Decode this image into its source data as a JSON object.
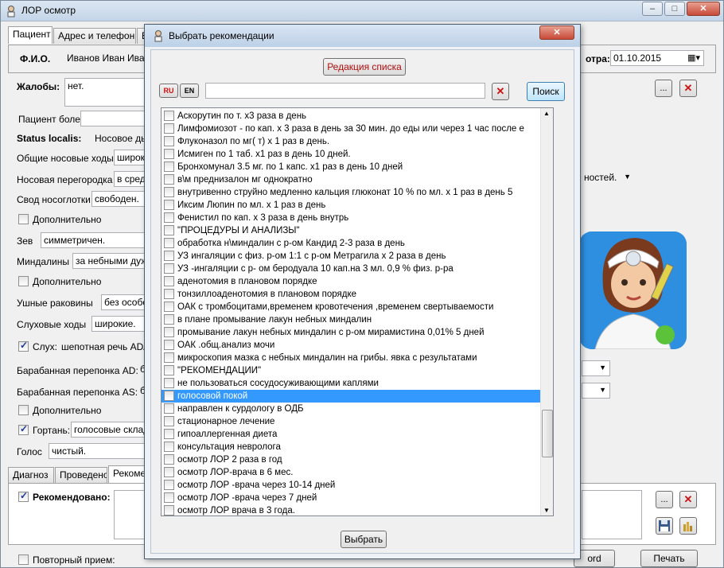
{
  "main": {
    "title": "ЛОР осмотр",
    "tabs": [
      "Пациент",
      "Адрес и телефон",
      "Вр"
    ],
    "fio_label": "Ф.И.О.",
    "fio_value": "Иванов Иван Иван",
    "date_label": "отра:",
    "date_value": "01.10.2015",
    "complaints_label": "Жалобы:",
    "complaints_value": "нет.",
    "patient_ill_label": "Пациент болен",
    "status_label": "Status localis:",
    "status_value": "Носовое ды",
    "rows": [
      {
        "label": "Общие носовые ходы",
        "value": "широки"
      },
      {
        "label": "Носовая перегородка",
        "value": "в средн"
      },
      {
        "label": "Свод носоглотки",
        "value": "свободен."
      },
      {
        "label": "Зев",
        "value": "симметричен."
      },
      {
        "label": "Миндалины",
        "value": "за небными дужк"
      },
      {
        "label": "Ушные раковины",
        "value": "без особе"
      },
      {
        "label": "Слуховые ходы",
        "value": "широкие."
      },
      {
        "label": "Барабанная перепонка AD:",
        "value": "б"
      },
      {
        "label": "Барабанная перепонка AS:",
        "value": "б"
      },
      {
        "label": "Голос",
        "value": "чистый."
      }
    ],
    "nose_right_value": "ностей.",
    "extra_label": "Дополнительно",
    "hearing_label": "Слух:",
    "hearing_value": "шепотная речь AD/AS",
    "larynx_label": "Гортань:",
    "larynx_value": "голосовые склад",
    "bottom_tabs": [
      "Диагноз",
      "Проведено",
      "Рекоме"
    ],
    "recommended_label": "Рекомендовано:",
    "repeat_label": "Повторный прием:",
    "word_btn": "ord",
    "print_btn": "Печать",
    "small_btn": "..."
  },
  "dialog": {
    "title": "Выбрать рекомендации",
    "edit_list_btn": "Редакция списка",
    "lang_ru": "RU",
    "lang_en": "EN",
    "search_value": "",
    "search_btn": "Поиск",
    "select_btn": "Выбрать",
    "selected_index": 23,
    "items": [
      "Аскорутин по   т. х3 раза в день",
      "Лимфомиозот - по   кап. х 3 раза в день за 30 мин. до еды или через 1 час после е",
      "Флуконазол по   мг(   т)  х 1 раз в день.",
      "Исмиген по 1 таб. х1 раз в день 10 дней.",
      "Бронхомунал 3.5 мг. по 1 капс. х1 раз в день 10 дней",
      "в\\м преднизалон  мг однократно",
      "внутривенно струйно медленно кальция глюконат 10 % по     мл.  х 1 раз в день 5",
      "Иксим Люпин по   мл. х 1 раз в день",
      "Фенистил по    кап. х 3 раза в день внутрь",
      "\"ПРОЦЕДУРЫ И АНАЛИЗЫ\"",
      "обработка н\\миндалин с р-ом Кандид 2-3 раза в день",
      "УЗ ингаляции с физ. р-ом 1:1 с р-ом Метрагила х 2 раза в день",
      "УЗ -ингаляции с р- ом беродуала 10 кап.на 3 мл. 0,9 % физ. р-ра",
      "аденотомия в плановом порядке",
      "тонзиллоаденотомия в плановом порядке",
      "ОАК с тромбоцитами,временем кровотечения ,временем свертываемости",
      "в плане промывание лакун небных миндалин",
      "промывание лакун небных миндалин с р-ом мирамистина 0,01%  5 дней",
      "ОАК .общ.анализ мочи",
      "микроскопия мазка с небных миндалин на грибы. явка с результатами",
      "\"РЕКОМЕНДАЦИИ\"",
      "не пользоваться сосудосуживающими каплями",
      "голосовой покой",
      "направлен к сурдологу в ОДБ",
      "стационарное лечение",
      "гипоаллергенная диета",
      "консультация невролога",
      "осмотр ЛОР 2 раза в год",
      "осмотр ЛОР-врача в 6 мес.",
      "осмотр ЛОР -врача через 10-14 дней",
      "осмотр ЛОР -врача через 7 дней",
      "осмотр ЛОР врача в 3 года."
    ],
    "scroll_position": 0.86
  }
}
